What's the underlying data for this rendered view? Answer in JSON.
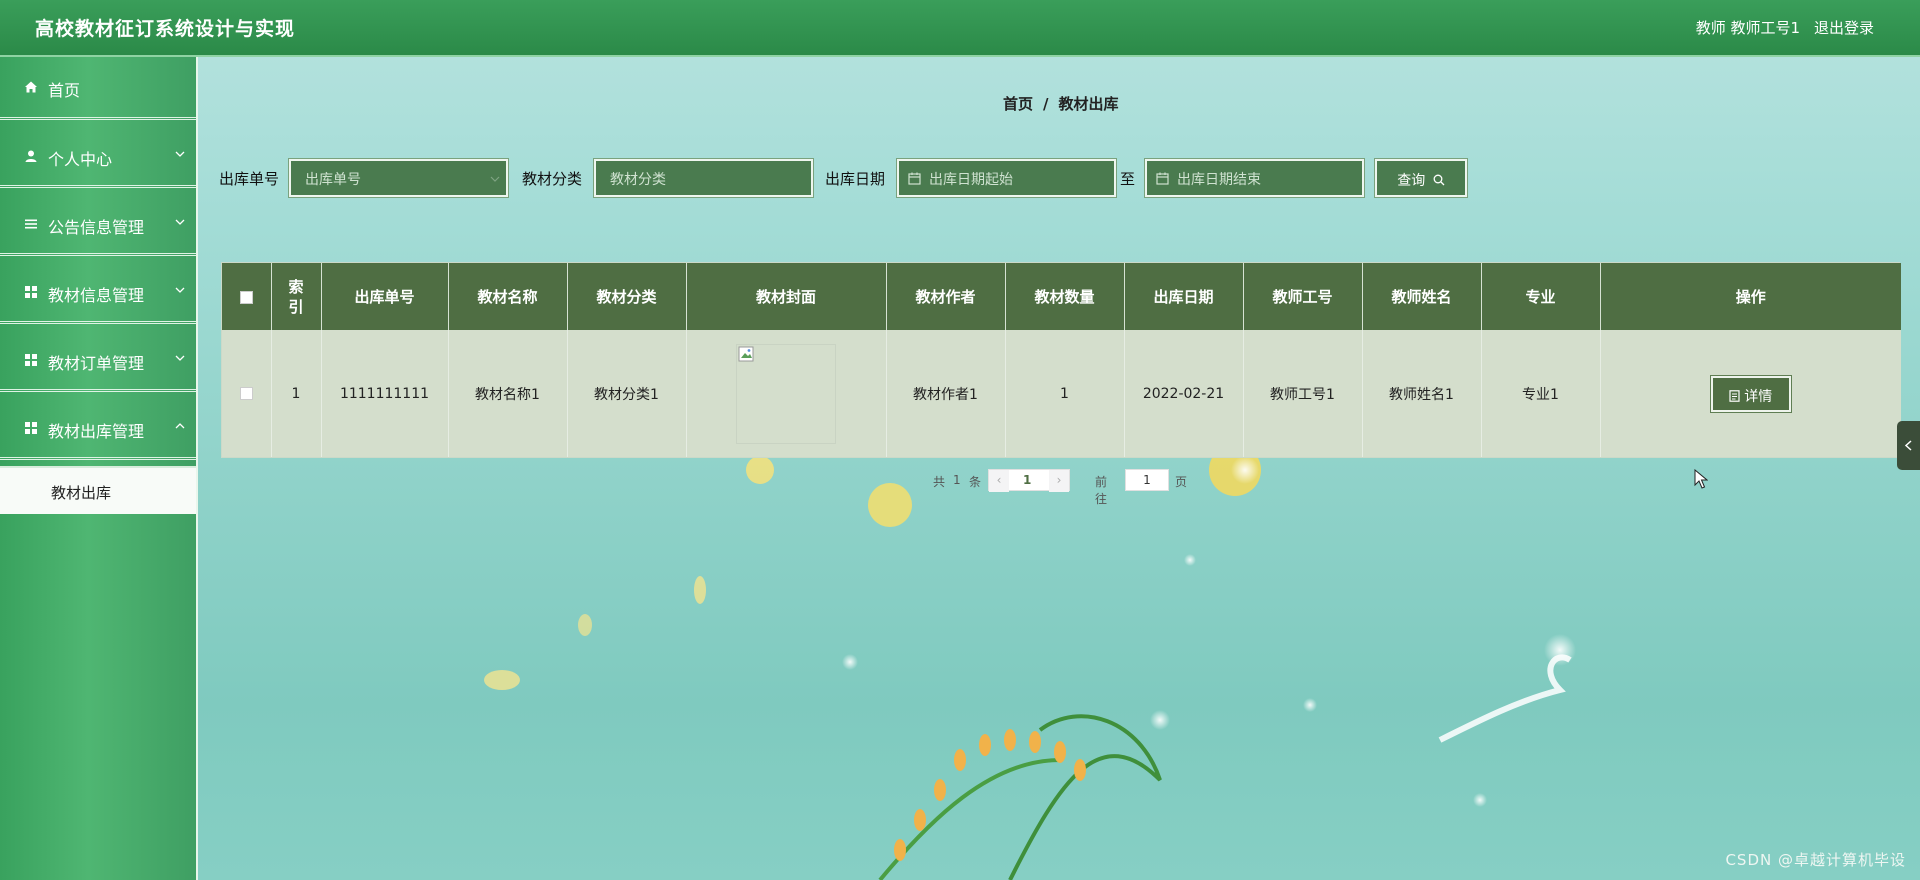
{
  "header": {
    "title": "高校教材征订系统设计与实现",
    "user": "教师  教师工号1",
    "logout": "退出登录"
  },
  "sidebar": {
    "items": [
      {
        "label": "首页",
        "icon": "home-icon"
      },
      {
        "label": "个人中心",
        "icon": "user-icon"
      },
      {
        "label": "公告信息管理",
        "icon": "list-icon"
      },
      {
        "label": "教材信息管理",
        "icon": "grid-icon"
      },
      {
        "label": "教材订单管理",
        "icon": "grid-icon"
      },
      {
        "label": "教材出库管理",
        "icon": "grid-icon"
      }
    ],
    "submenu": "教材出库"
  },
  "breadcrumb": {
    "home": "首页",
    "sep": "/",
    "current": "教材出库"
  },
  "search": {
    "order_label": "出库单号",
    "order_placeholder": "出库单号",
    "category_label": "教材分类",
    "category_placeholder": "教材分类",
    "date_label": "出库日期",
    "date_start_placeholder": "出库日期起始",
    "date_to": "至",
    "date_end_placeholder": "出库日期结束",
    "query_button": "查询"
  },
  "table": {
    "headers": [
      "索引",
      "出库单号",
      "教材名称",
      "教材分类",
      "教材封面",
      "教材作者",
      "教材数量",
      "出库日期",
      "教师工号",
      "教师姓名",
      "专业",
      "操作"
    ],
    "rows": [
      {
        "index": "1",
        "order_no": "1111111111",
        "name": "教材名称1",
        "category": "教材分类1",
        "author": "教材作者1",
        "quantity": "1",
        "date": "2022-02-21",
        "teacher_id": "教师工号1",
        "teacher_name": "教师姓名1",
        "major": "专业1",
        "action": "详情"
      }
    ]
  },
  "pagination": {
    "total_prefix": "共",
    "total": "1",
    "total_suffix": "条",
    "current_page": "1",
    "goto_prefix": "前往",
    "goto_value": "1",
    "goto_suffix": "页"
  },
  "watermark": "CSDN @卓越计算机毕设",
  "colors": {
    "header": "#2b8a48",
    "sidebar": "#4fb672",
    "table_header": "#4f6e43",
    "table_row": "#d4decc",
    "input_bg": "#4a7b4f"
  }
}
